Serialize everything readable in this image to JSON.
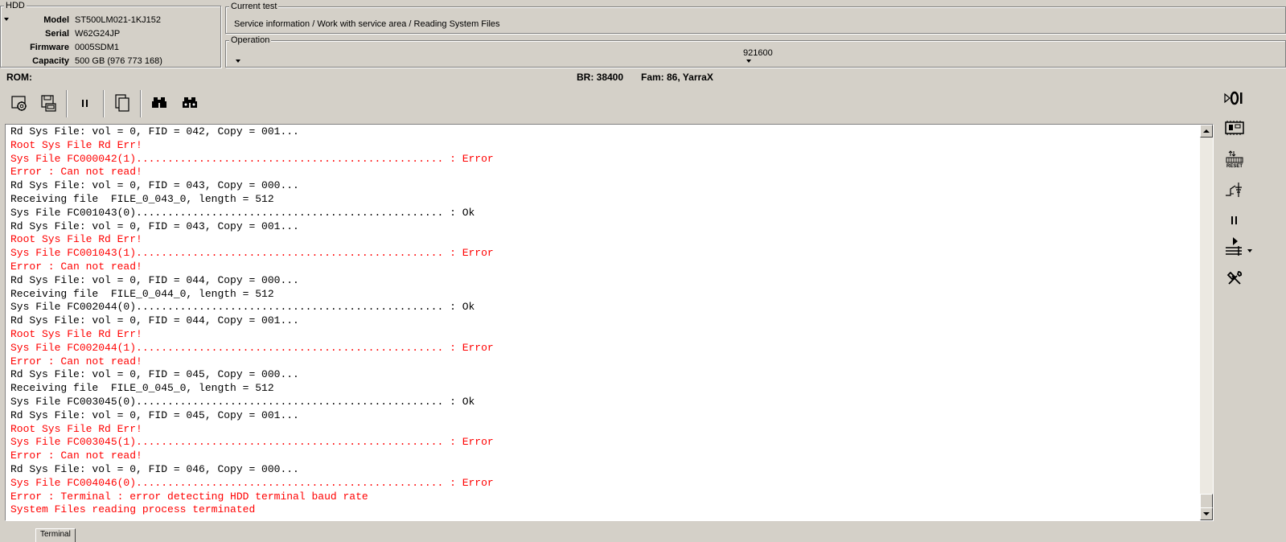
{
  "hdd": {
    "title": "HDD",
    "fields": [
      {
        "label": "Model",
        "value": "ST500LM021-1KJ152"
      },
      {
        "label": "Serial",
        "value": "W62G24JP"
      },
      {
        "label": "Firmware",
        "value": "0005SDM1"
      },
      {
        "label": "Capacity",
        "value": "500 GB (976 773 168)"
      }
    ]
  },
  "current_test": {
    "title": "Current test",
    "value": "Service information / Work with service area / Reading System Files"
  },
  "operation": {
    "title": "Operation",
    "baud": "921600"
  },
  "status": {
    "rom": "ROM:",
    "br": "BR: 38400",
    "fam": "Fam: 86, YarraX"
  },
  "log": [
    {
      "text": "Rd Sys File: vol = 0, FID = 042, Copy = 001...",
      "type": "ok"
    },
    {
      "text": "Root Sys File Rd Err!",
      "type": "err"
    },
    {
      "text": "Sys File FC000042(1)................................................. : Error",
      "type": "err"
    },
    {
      "text": "Error : Can not read!",
      "type": "err"
    },
    {
      "text": "Rd Sys File: vol = 0, FID = 043, Copy = 000...",
      "type": "ok"
    },
    {
      "text": "Receiving file  FILE_0_043_0, length = 512",
      "type": "ok"
    },
    {
      "text": "Sys File FC001043(0)................................................. : Ok",
      "type": "ok"
    },
    {
      "text": "Rd Sys File: vol = 0, FID = 043, Copy = 001...",
      "type": "ok"
    },
    {
      "text": "Root Sys File Rd Err!",
      "type": "err"
    },
    {
      "text": "Sys File FC001043(1)................................................. : Error",
      "type": "err"
    },
    {
      "text": "Error : Can not read!",
      "type": "err"
    },
    {
      "text": "Rd Sys File: vol = 0, FID = 044, Copy = 000...",
      "type": "ok"
    },
    {
      "text": "Receiving file  FILE_0_044_0, length = 512",
      "type": "ok"
    },
    {
      "text": "Sys File FC002044(0)................................................. : Ok",
      "type": "ok"
    },
    {
      "text": "Rd Sys File: vol = 0, FID = 044, Copy = 001...",
      "type": "ok"
    },
    {
      "text": "Root Sys File Rd Err!",
      "type": "err"
    },
    {
      "text": "Sys File FC002044(1)................................................. : Error",
      "type": "err"
    },
    {
      "text": "Error : Can not read!",
      "type": "err"
    },
    {
      "text": "Rd Sys File: vol = 0, FID = 045, Copy = 000...",
      "type": "ok"
    },
    {
      "text": "Receiving file  FILE_0_045_0, length = 512",
      "type": "ok"
    },
    {
      "text": "Sys File FC003045(0)................................................. : Ok",
      "type": "ok"
    },
    {
      "text": "Rd Sys File: vol = 0, FID = 045, Copy = 001...",
      "type": "ok"
    },
    {
      "text": "Root Sys File Rd Err!",
      "type": "err"
    },
    {
      "text": "Sys File FC003045(1)................................................. : Error",
      "type": "err"
    },
    {
      "text": "Error : Can not read!",
      "type": "err"
    },
    {
      "text": "Rd Sys File: vol = 0, FID = 046, Copy = 000...",
      "type": "ok"
    },
    {
      "text": "Sys File FC004046(0)................................................. : Error",
      "type": "err"
    },
    {
      "text": "Error : Terminal : error detecting HDD terminal baud rate",
      "type": "err"
    },
    {
      "text": "System Files reading process terminated",
      "type": "err"
    }
  ],
  "tabs": {
    "terminal": "Terminal"
  },
  "right_toolbar": {
    "reset_label": "RESET"
  },
  "icons": {
    "toolbar": [
      "settings-gear-icon",
      "save-disk-icon",
      "pause-icon",
      "copy-icon",
      "binoculars-icon",
      "binoculars-next-icon"
    ],
    "right": [
      "power-icon",
      "pcb-board-icon",
      "reset-icon",
      "relay-icon",
      "pause-icon",
      "play-menu-icon",
      "tools-icon"
    ]
  },
  "colors": {
    "background": "#d4d0c8",
    "error_text": "#ff0000",
    "normal_text": "#000000",
    "log_bg": "#ffffff"
  }
}
